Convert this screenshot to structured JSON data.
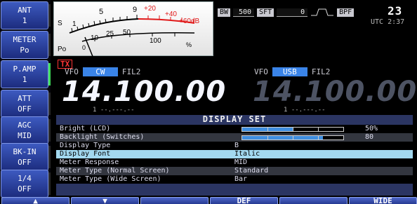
{
  "left_keys": [
    {
      "line1": "ANT",
      "line2": "1",
      "indicator_on": false
    },
    {
      "line1": "METER",
      "line2": "Po",
      "indicator_on": false
    },
    {
      "line1": "P.AMP",
      "line2": "1",
      "indicator_on": true
    },
    {
      "line1": "ATT",
      "line2": "OFF",
      "indicator_on": false
    },
    {
      "line1": "AGC",
      "line2": "MID",
      "indicator_on": false
    },
    {
      "line1": "BK-IN",
      "line2": "OFF",
      "indicator_on": false
    },
    {
      "line1": "1/4",
      "line2": "OFF",
      "indicator_on": false
    }
  ],
  "meter": {
    "s_label": "S",
    "po_label": "Po",
    "s_scale": [
      "1",
      "5",
      "9",
      "+20",
      "+40",
      "+60dB"
    ],
    "po_scale": [
      "0",
      "10",
      "25",
      "50",
      "100",
      "%"
    ]
  },
  "status": {
    "bw_label": "BW",
    "bw_value": "500",
    "sft_label": "SFT",
    "sft_value": "0",
    "bpf_label": "BPF",
    "clock": "23",
    "utc": "UTC 2:37"
  },
  "tx_badge": "TX",
  "main_vfo": {
    "label": "VFO",
    "mode": "CW",
    "filter": "FIL2",
    "frequency": "14.100.00",
    "sub_freq": "1 --.---.--"
  },
  "sub_vfo": {
    "label": "VFO",
    "mode": "USB",
    "filter": "FIL2",
    "frequency": "14.100.00",
    "sub_freq": "1 --.---.--"
  },
  "panel": {
    "title": "DISPLAY SET",
    "rows": [
      {
        "label": "Bright (LCD)",
        "type": "bar",
        "percent": 50,
        "value": "50%"
      },
      {
        "label": "Backlight (Switches)",
        "type": "bar",
        "percent": 80,
        "value": "80"
      },
      {
        "label": "Display Type",
        "type": "text",
        "value": "B"
      },
      {
        "label": "Display Font",
        "type": "text",
        "value": "Italic",
        "selected": true
      },
      {
        "label": "Meter Response",
        "type": "text",
        "value": "MID"
      },
      {
        "label": "Meter Type (Normal Screen)",
        "type": "text",
        "value": "Standard"
      },
      {
        "label": "Meter Type (Wide Screen)",
        "type": "text",
        "value": "Bar"
      }
    ]
  },
  "softkeys": [
    "▲",
    "▼",
    "",
    "DEF",
    "",
    "WIDE"
  ],
  "colors": {
    "accent": "#3a84e8",
    "selected_row": "#a3d9f0",
    "tx_red": "#ff3434",
    "panel_bg": "#2b3562"
  }
}
